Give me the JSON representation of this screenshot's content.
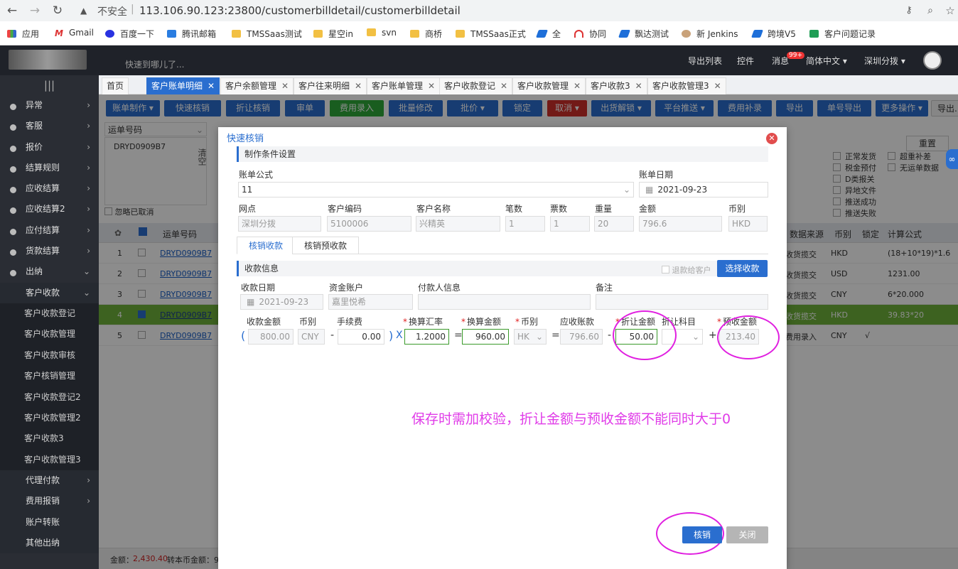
{
  "browser": {
    "insecure": "不安全",
    "url": "113.106.90.123:23800/customerbilldetail/customerbilldetail",
    "bookmarks": [
      "应用",
      "Gmail",
      "百度一下",
      "腾讯邮箱",
      "TMSSaas测试",
      "星空in",
      "svn",
      "商桥",
      "TMSSaas正式",
      "全",
      "协同",
      "飘达测试",
      "新 Jenkins",
      "跨境V5",
      "客户问题记录"
    ]
  },
  "header": {
    "goto_placeholder": "快速到哪儿了...",
    "export_list": "导出列表",
    "controls": "控件",
    "messages": "消息",
    "message_count": "99+",
    "language": "简体中文 ▾",
    "branch": "深圳分拨 ▾"
  },
  "sidebar": {
    "toggle": "|||",
    "items": [
      {
        "label": "异常",
        "chev": "›"
      },
      {
        "label": "客服",
        "chev": "›"
      },
      {
        "label": "报价",
        "chev": "›"
      },
      {
        "label": "结算规则",
        "chev": "›"
      },
      {
        "label": "应收结算",
        "chev": "›"
      },
      {
        "label": "应收结算2",
        "chev": "›"
      },
      {
        "label": "应付结算",
        "chev": "›"
      },
      {
        "label": "货款结算",
        "chev": "›"
      },
      {
        "label": "出纳",
        "chev": "⌄"
      }
    ],
    "sub_group": {
      "label": "客户收款",
      "chev": "⌄"
    },
    "sub_items": [
      "客户收款登记",
      "客户收款管理",
      "客户收款审核",
      "客户核销管理",
      "客户收款登记2",
      "客户收款管理2",
      "客户收款3",
      "客户收款管理3"
    ],
    "after": [
      {
        "label": "代理付款",
        "chev": "›"
      },
      {
        "label": "费用报销",
        "chev": "›"
      },
      {
        "label": "账户转账",
        "chev": ""
      },
      {
        "label": "其他出纳",
        "chev": ""
      }
    ]
  },
  "tabs": [
    "首页",
    "客户账单明细",
    "客户余额管理",
    "客户往来明细",
    "客户账单管理",
    "客户收款登记",
    "客户收款管理",
    "客户收款3",
    "客户收款管理3"
  ],
  "toolbar": [
    "账单制作 ▾",
    "快速核销",
    "折让核销",
    "审单",
    "费用录入",
    "批量修改",
    "批价 ▾",
    "锁定",
    "取消 ▾",
    "出货解锁 ▾",
    "平台推送 ▾",
    "费用补录",
    "导出",
    "单号导出",
    "更多操作 ▾",
    "导出..."
  ],
  "filters": {
    "waybill_select": "运单号码",
    "waybill_value": "DRYD0909B7",
    "ignore_cancelled": "忽略已取消",
    "clear": "清空",
    "reset": "重置",
    "options": [
      "超重补差",
      "无运单数据",
      "正常发货",
      "税金预付",
      "D类报关",
      "异地文件",
      "推送成功",
      "推送失败"
    ]
  },
  "grid": {
    "headers": [
      "运单号码",
      "数据来源",
      "币别",
      "锁定",
      "计算公式"
    ],
    "rows": [
      {
        "no": "1",
        "waybill": "DRYD0909B7",
        "source": "收货揽交",
        "currency": "HKD",
        "lock": "",
        "formula": "(18+10*19)*1.6",
        "checked": false
      },
      {
        "no": "2",
        "waybill": "DRYD0909B7",
        "source": "收货揽交",
        "currency": "USD",
        "lock": "",
        "formula": "1231.00",
        "checked": false
      },
      {
        "no": "3",
        "waybill": "DRYD0909B7",
        "source": "收货揽交",
        "currency": "CNY",
        "lock": "",
        "formula": "6*20.000",
        "checked": false
      },
      {
        "no": "4",
        "waybill": "DRYD0909B7",
        "source": "收货揽交",
        "currency": "HKD",
        "lock": "",
        "formula": "39.83*20",
        "checked": true
      },
      {
        "no": "5",
        "waybill": "DRYD0909B7",
        "source": "费用录入",
        "currency": "CNY",
        "lock": "√",
        "formula": "",
        "checked": false
      }
    ],
    "footer_amount_label": "金额：",
    "footer_amount": "2,430.40",
    "footer_local_label": "转本币金额：9,..."
  },
  "modal": {
    "title": "快速核销",
    "close": "✕",
    "section1": "制作条件设置",
    "bill_formula_label": "账单公式",
    "bill_formula": "11",
    "bill_date_label": "账单日期",
    "bill_date": "2021-09-23",
    "info_labels": [
      "网点",
      "客户编码",
      "客户名称",
      "笔数",
      "票数",
      "重量",
      "金额",
      "币别"
    ],
    "info_values": [
      "深圳分拨",
      "5100006",
      "兴精英",
      "1",
      "1",
      "20",
      "796.6",
      "HKD"
    ],
    "subtabs": [
      "核销收款",
      "核销预收款"
    ],
    "section2": "收款信息",
    "refund_to_customer": "退款给客户",
    "select_receipt": "选择收款",
    "receipt_date_label": "收款日期",
    "receipt_date": "2021-09-23",
    "account_label": "资金账户",
    "account": "嘉里悦希",
    "payer_label": "付款人信息",
    "remark_label": "备注",
    "calc": {
      "receipt_amount_label": "收款金额",
      "receipt_amount": "800.00",
      "currency_label": "币别",
      "currency": "CNY",
      "fee_label": "手续费",
      "fee": "0.00",
      "rate_label": "换算汇率",
      "rate": "1.2000",
      "converted_label": "换算金额",
      "converted": "960.00",
      "currency2_label": "币别",
      "currency2": "HK",
      "receivable_label": "应收账款",
      "receivable": "796.60",
      "discount_label": "折让金额",
      "discount": "50.00",
      "discount_subject_label": "折让科目",
      "prepaid_label": "预收金额",
      "prepaid": "213.40",
      "ops": [
        "(",
        "-",
        ")",
        "X",
        "=",
        "=",
        "-",
        "+"
      ]
    },
    "note": "保存时需加校验，折让金额与预收金额不能同时大于0",
    "confirm": "核销",
    "cancel": "关闭"
  },
  "colors": {
    "accent": "#2a6ecf",
    "annotation": "#e020e0",
    "selected_row": "#6fb33b"
  }
}
